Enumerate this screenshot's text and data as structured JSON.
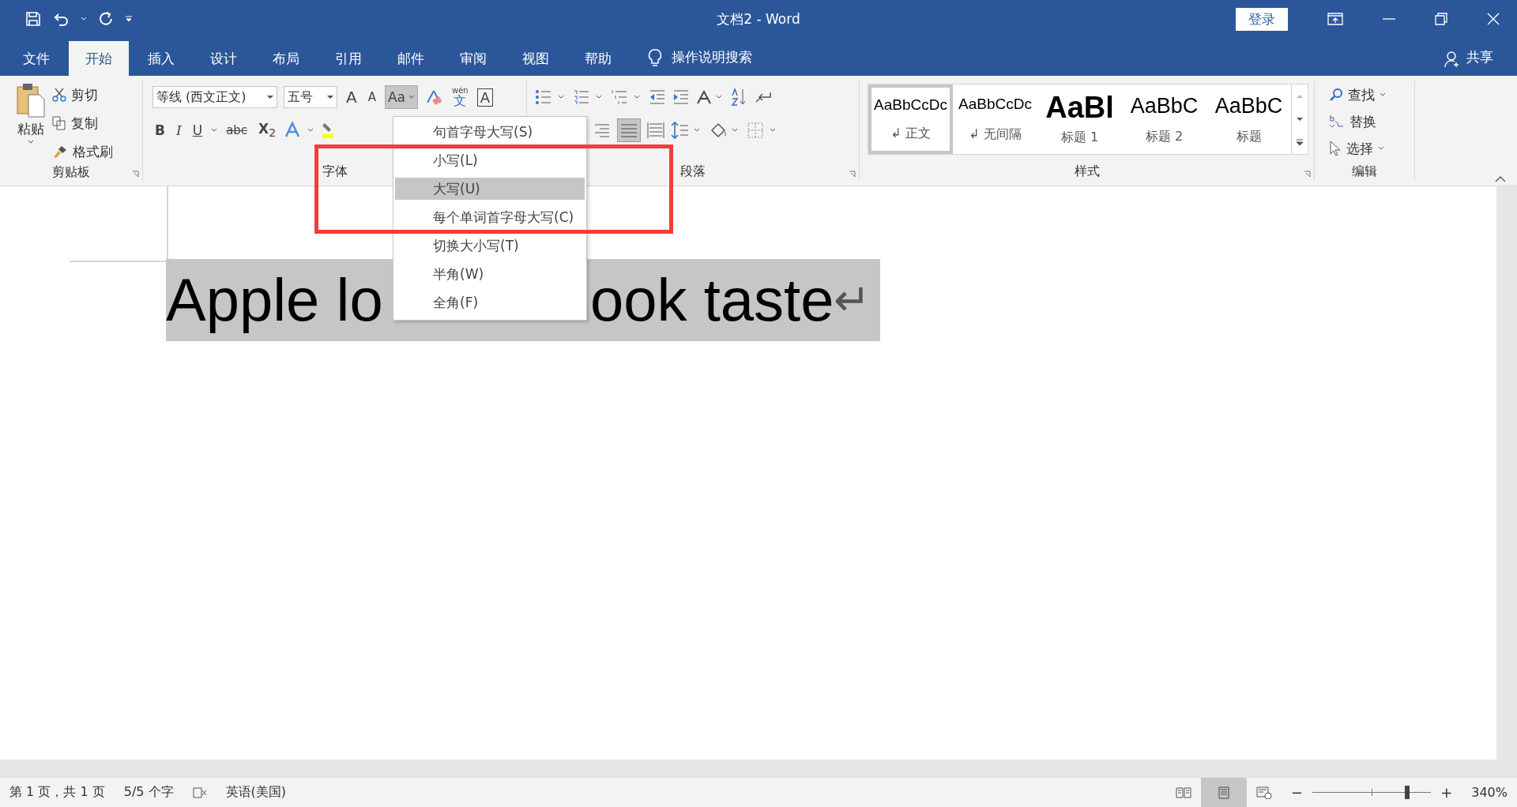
{
  "window": {
    "title": "文档2  -  Word",
    "login": "登录"
  },
  "tabs": [
    {
      "label": "文件",
      "selected": false
    },
    {
      "label": "开始",
      "selected": true
    },
    {
      "label": "插入",
      "selected": false
    },
    {
      "label": "设计",
      "selected": false
    },
    {
      "label": "布局",
      "selected": false
    },
    {
      "label": "引用",
      "selected": false
    },
    {
      "label": "邮件",
      "selected": false
    },
    {
      "label": "审阅",
      "selected": false
    },
    {
      "label": "视图",
      "selected": false
    },
    {
      "label": "帮助",
      "selected": false
    }
  ],
  "tell_me": "操作说明搜索",
  "share": "共享",
  "clipboard": {
    "paste": "粘贴",
    "cut": "剪切",
    "copy": "复制",
    "format_painter": "格式刷",
    "label": "剪贴板"
  },
  "font": {
    "name": "等线 (西文正文)",
    "size": "五号",
    "grow": "A",
    "shrink": "A",
    "case": "Aa",
    "phonetic_top": "wén",
    "phonetic": "文",
    "border_char": "A",
    "bold": "B",
    "italic": "I",
    "underline": "U",
    "strike": "abc",
    "subscript": "X",
    "sub_mark": "2",
    "label": "字体"
  },
  "paragraph": {
    "label": "段落"
  },
  "styles": {
    "label": "样式",
    "items": [
      {
        "preview": "AaBbCcDc",
        "name": "↲ 正文",
        "kind": "normal",
        "selected": true
      },
      {
        "preview": "AaBbCcDc",
        "name": "↲ 无间隔",
        "kind": "normal",
        "selected": false
      },
      {
        "preview": "AaBl",
        "name": "标题 1",
        "kind": "heading1",
        "selected": false
      },
      {
        "preview": "AaBbC",
        "name": "标题 2",
        "kind": "heading2",
        "selected": false
      },
      {
        "preview": "AaBbC",
        "name": "标题",
        "kind": "title",
        "selected": false
      }
    ]
  },
  "editing": {
    "label": "编辑",
    "find": "查找",
    "replace": "替换",
    "select": "选择"
  },
  "case_menu": [
    {
      "label": "句首字母大写(S)",
      "selected": false
    },
    {
      "label": "小写(L)",
      "selected": false
    },
    {
      "label": "大写(U)",
      "selected": true
    },
    {
      "label": "每个单词首字母大写(C)",
      "selected": false
    },
    {
      "label": "切换大小写(T)",
      "selected": false
    },
    {
      "label": "半角(W)",
      "selected": false
    },
    {
      "label": "全角(F)",
      "selected": false
    }
  ],
  "document": {
    "text_before": "Apple lo",
    "text_after": "ook taste",
    "paragraph_mark": "↵"
  },
  "status_bar": {
    "page": "第 1 页，共 1 页",
    "words": "5/5 个字",
    "language": "英语(美国)",
    "zoom_minus": "−",
    "zoom_plus": "+",
    "zoom": "340%",
    "zoom_slider": {
      "level": 0.8
    }
  }
}
